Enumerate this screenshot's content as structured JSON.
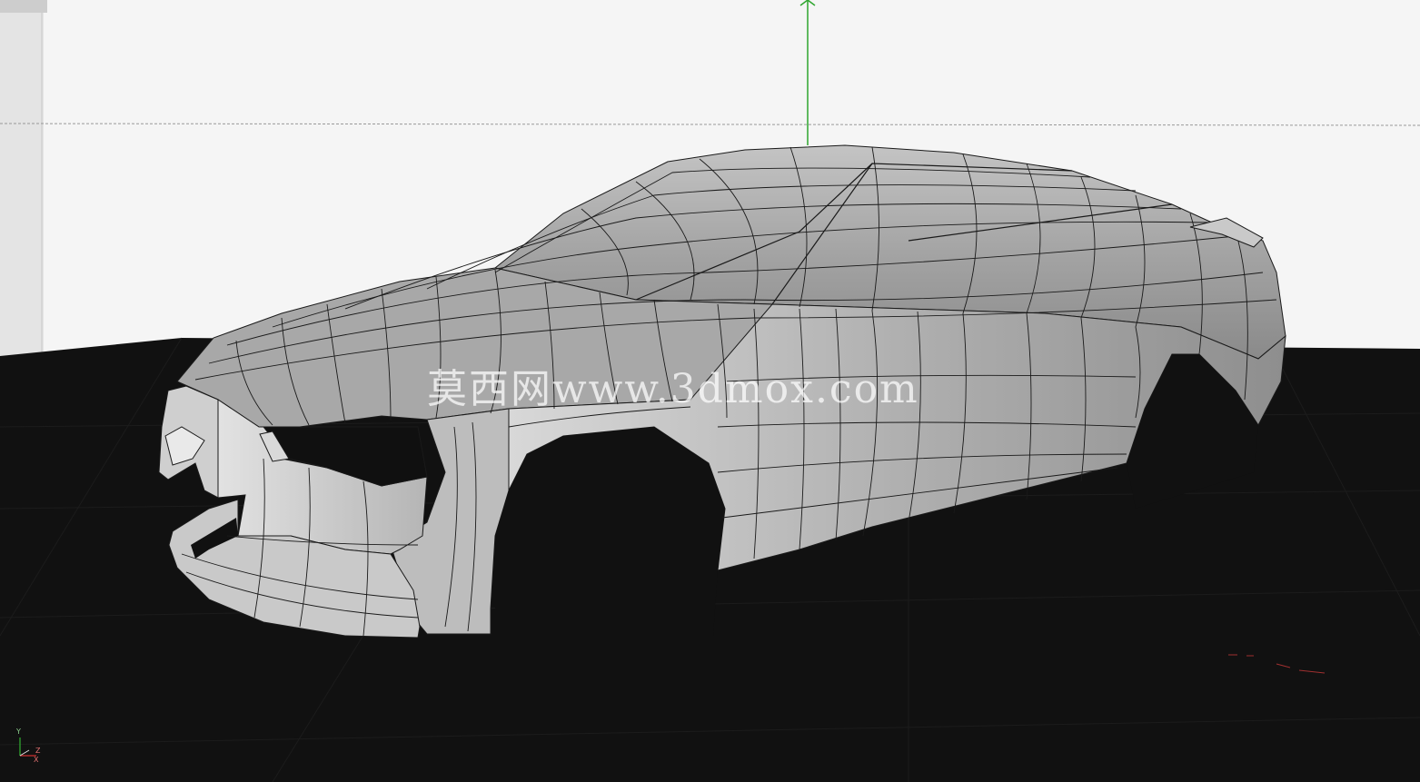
{
  "viewport": {
    "watermark_text": "莫西网www.3dmox.com",
    "colors": {
      "background_sky": "#f5f5f5",
      "ground": "#111111",
      "mesh_fill": "#a9a9a9",
      "mesh_wire": "#1a1a1a",
      "y_axis": "#2fa62f",
      "x_axis": "#d03030"
    },
    "axis_gizmo": {
      "y_label": "Y",
      "x_label": "X",
      "z_label": "Z"
    },
    "icons": [
      "move-gizmo-y-arrow-icon",
      "axis-orientation-gizmo-icon"
    ]
  }
}
